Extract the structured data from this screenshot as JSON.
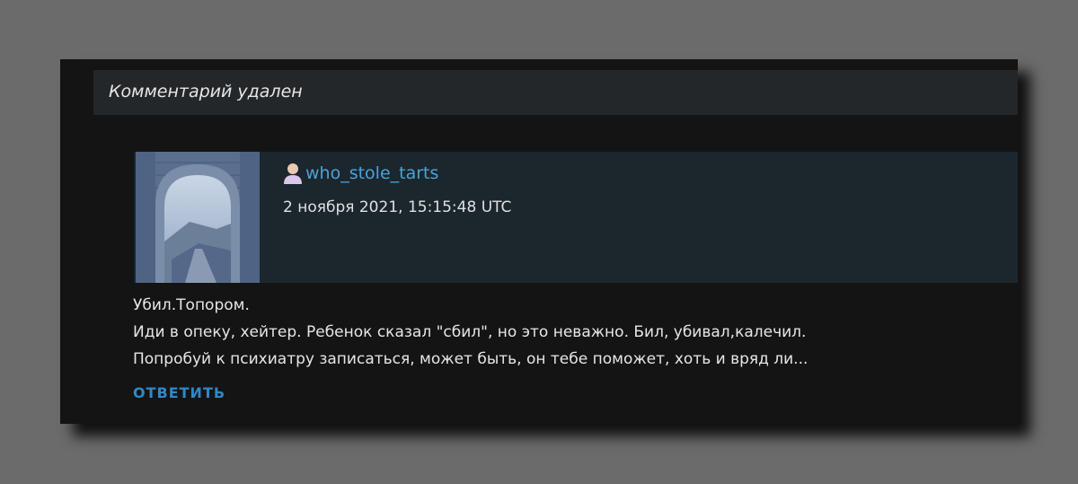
{
  "deleted_notice": "Комментарий удален",
  "comment": {
    "username": "who_stole_tarts",
    "timestamp": "2 ноября 2021, 15:15:48 UTC",
    "body": [
      "Убил.Топором.",
      "Иди в опеку, хейтер. Ребенок сказал \"сбил\", но это неважно. Бил, убивал,калечил.",
      "Попробуй к психиатру записаться, может быть, он тебе поможет, хоть и вряд ли..."
    ],
    "reply_label": "ОТВЕТИТЬ"
  },
  "colors": {
    "background": "#6b6b6b",
    "panel": "#141414",
    "deleted_bar": "#24272a",
    "comment_header": "#1b262d",
    "username": "#4aa3d8",
    "reply": "#2f88c8"
  },
  "icons": {
    "user": "user-avatar-icon",
    "avatar": "stone-archway-photo"
  }
}
